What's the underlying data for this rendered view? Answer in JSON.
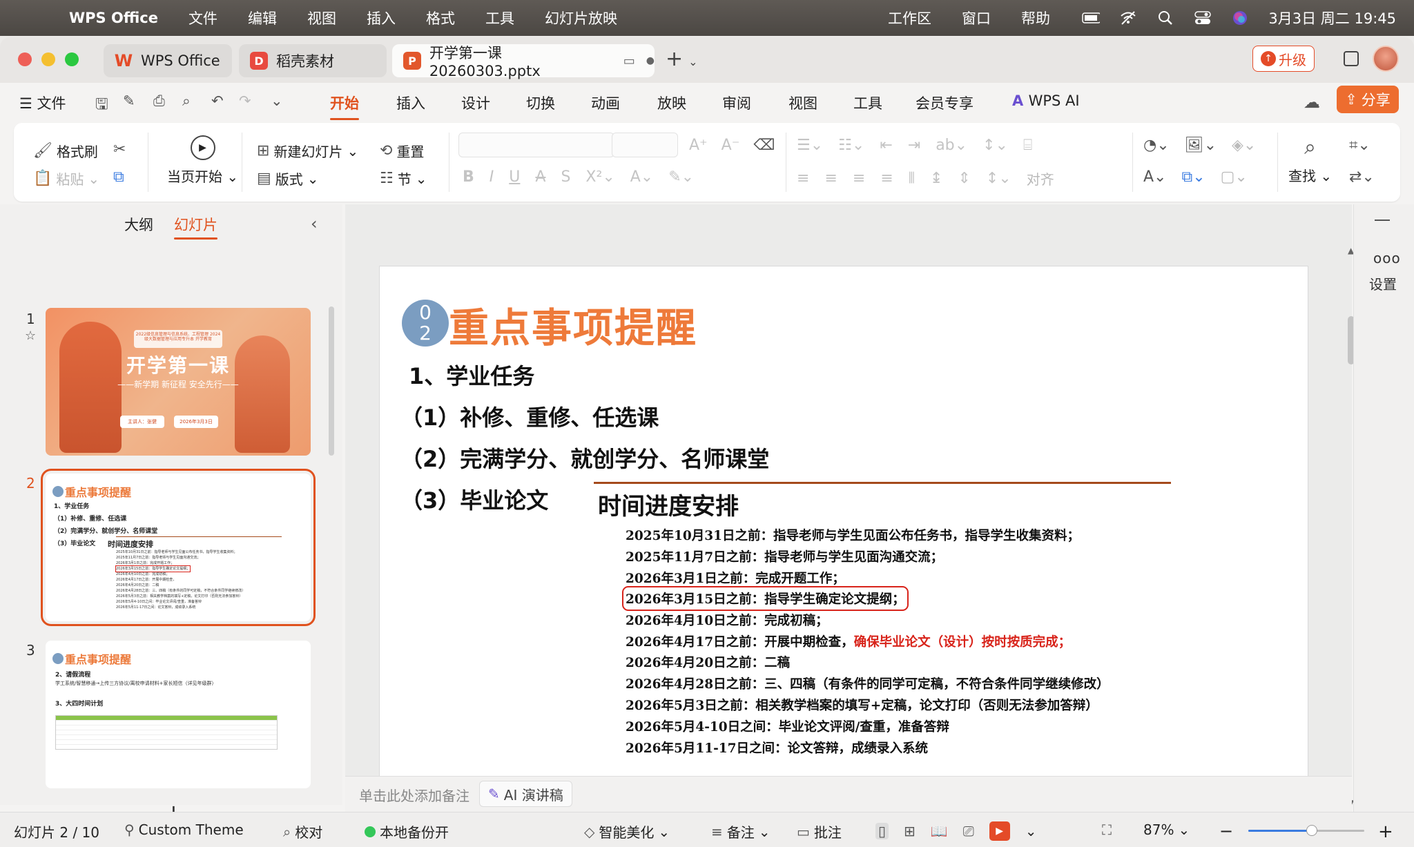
{
  "menubar": {
    "app": "WPS Office",
    "items": [
      "文件",
      "编辑",
      "视图",
      "插入",
      "格式",
      "工具",
      "幻灯片放映"
    ],
    "right_items": [
      "工作区",
      "窗口",
      "帮助"
    ],
    "clock": "3月3日 周二 19:45"
  },
  "tabs": {
    "wps": "WPS Office",
    "daoke": "稻壳素材",
    "file": "开学第一课20260303.pptx",
    "upgrade": "升级"
  },
  "ribbon_tabs": {
    "file": "文件",
    "items": [
      "开始",
      "插入",
      "设计",
      "切换",
      "动画",
      "放映",
      "审阅",
      "视图",
      "工具",
      "会员专享"
    ],
    "ai": "WPS AI",
    "share": "分享"
  },
  "ribbon": {
    "format_painter": "格式刷",
    "paste": "粘贴",
    "start_current": "当页开始",
    "new_slide": "新建幻灯片",
    "layout": "版式",
    "reset": "重置",
    "section": "节",
    "align": "对齐",
    "find": "查找"
  },
  "left_pane": {
    "outline_tab": "大纲",
    "slides_tab": "幻灯片",
    "slide_numbers": [
      "1",
      "2",
      "3"
    ],
    "thumb1": {
      "box": "2022级信息管理与信息系统、工程管理 2024级大数据管理与应用专升本 开学教育",
      "title": "开学第一课",
      "subtitle": "——新学期 新征程 安全先行——",
      "btn1": "主讲人：张健",
      "btn2": "2026年3月3日"
    },
    "thumb2": {
      "title": "重点事项提醒",
      "lines": [
        "1、学业任务",
        "（1）补修、重修、任选课",
        "（2）完满学分、就创学分、名师课堂",
        "（3）毕业论文"
      ],
      "sub": "时间进度安排"
    },
    "thumb3": {
      "title": "重点事项提醒",
      "l1": "2、请假流程",
      "l2": "学工系统/智慧移通→上传三方协议/离校申请材料+家长短信（详见年级群）",
      "l3": "3、大四时间计划"
    }
  },
  "slide": {
    "circle_num_top": "0",
    "circle_num_bottom": "2",
    "title": "重点事项提醒",
    "h1": "1、学业任务",
    "h2": "（1）补修、重修、任选课",
    "h3": "（2）完满学分、就创学分、名师课堂",
    "h4": "（3）毕业论文",
    "schedule_title": "时间进度安排",
    "schedule": [
      "2025年10月31日之前：指导老师与学生见面公布任务书，指导学生收集资料；",
      "2025年11月7日之前：指导老师与学生见面沟通交流；",
      "2026年3月1日之前：完成开题工作；",
      "2026年3月15日之前：指导学生确定论文提纲；",
      "2026年4月10日之前：完成初稿；",
      "2026年4月17日之前：开展中期检查，",
      "2026年4月20日之前：二稿",
      "2026年4月28日之前：三、四稿（有条件的同学可定稿，不符合条件同学继续修改）",
      "2026年5月3日之前：相关教学档案的填写+定稿，论文打印（否则无法参加答辩）",
      "2026年5月4-10日之间：毕业论文评阅/查重，准备答辩",
      "2026年5月11-17日之间：论文答辩，成绩录入系统"
    ],
    "schedule_red": "确保毕业论文（设计）按时按质完成；"
  },
  "notes": {
    "placeholder": "单击此处添加备注",
    "ai_script": "AI 演讲稿"
  },
  "right_pane": {
    "settings": "设置"
  },
  "status": {
    "slide_counter": "幻灯片 2 / 10",
    "theme": "Custom Theme",
    "proof": "校对",
    "backup": "本地备份开",
    "beautify": "智能美化",
    "notes": "备注",
    "comments": "批注",
    "zoom": "87%",
    "zoom_fraction": 0.55
  },
  "colors": {
    "accent": "#e0521e",
    "title_orange": "#ee7a3a",
    "highlight_red": "#d8231a",
    "circle_blue": "#7b9dc1"
  }
}
